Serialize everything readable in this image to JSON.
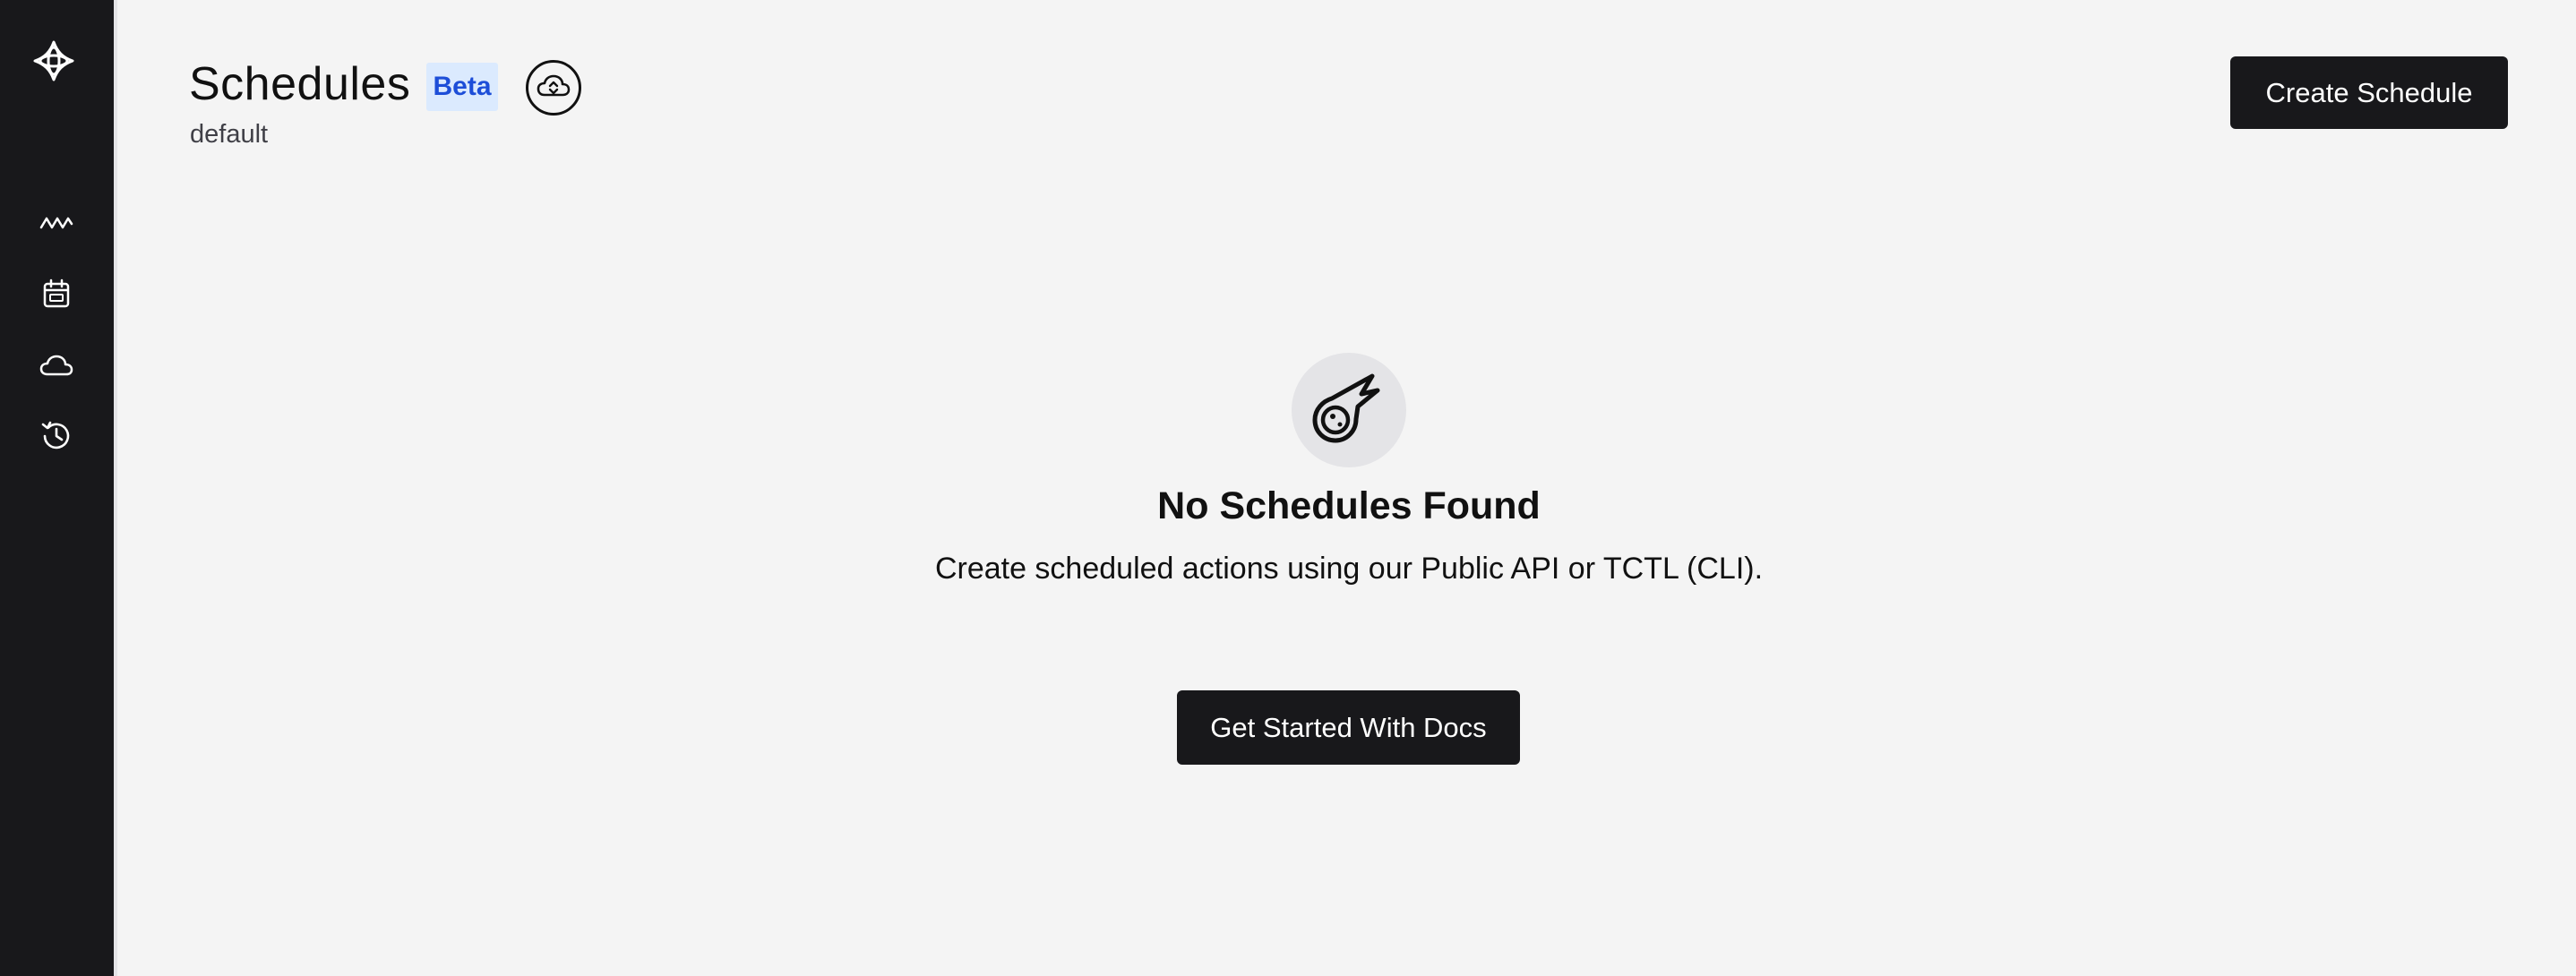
{
  "sidebar": {
    "items": [
      {
        "icon": "workflows-icon"
      },
      {
        "icon": "calendar-icon"
      },
      {
        "icon": "cloud-icon"
      },
      {
        "icon": "history-icon"
      }
    ],
    "logo_icon": "temporal-logo-icon"
  },
  "header": {
    "title": "Schedules",
    "badge": "Beta",
    "namespace": "default",
    "cloud_icon": "cloud-upload-download-icon",
    "create_label": "Create Schedule"
  },
  "empty_state": {
    "icon": "comet-icon",
    "title": "No Schedules Found",
    "description": "Create scheduled actions using our Public API or TCTL (CLI).",
    "button_label": "Get Started With Docs"
  },
  "colors": {
    "sidebar_bg": "#18181b",
    "page_bg": "#f4f4f4",
    "badge_bg": "#dbeafe",
    "badge_text": "#1d4ed8",
    "button_bg": "#18181b",
    "button_text": "#ffffff"
  }
}
